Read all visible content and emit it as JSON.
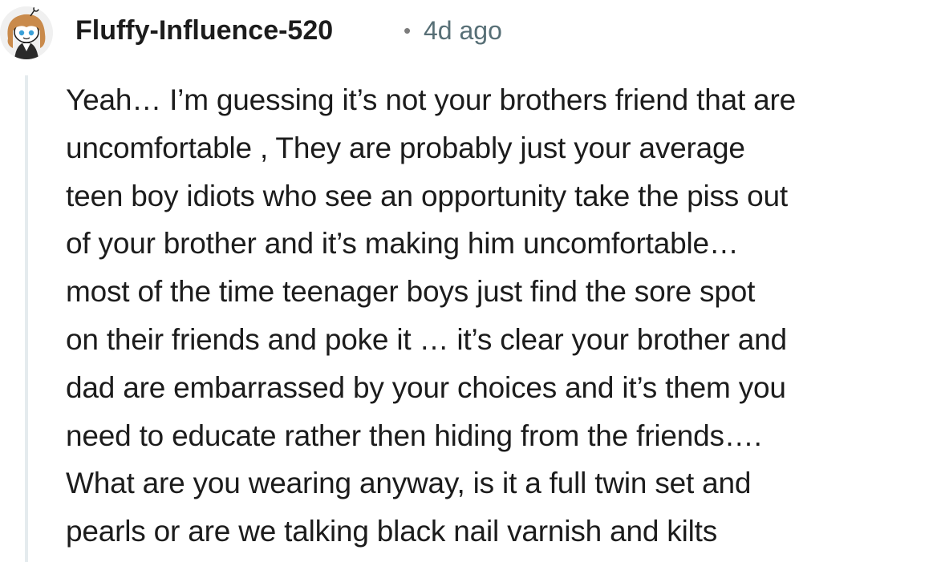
{
  "comment": {
    "author": "Fluffy-Influence-520",
    "separator": "•",
    "timestamp": "4d ago",
    "avatar_icon": "snoo-avatar-icon",
    "body_lines": [
      "Yeah… I’m guessing it’s not your brothers friend that are",
      "uncomfortable , They are probably just your average",
      "teen boy idiots who see an opportunity take the piss out",
      "of your brother and it’s making him uncomfortable…",
      "most of the time teenager boys just find the sore spot",
      "on their friends and poke it … it’s clear your brother and",
      "dad are embarrassed by your choices and it’s them you",
      "need to educate rather then hiding from the friends….",
      "What are you wearing anyway, is it a full twin set and",
      "pearls or are we talking black nail varnish and kilts"
    ]
  },
  "colors": {
    "text": "#1c1c1c",
    "meta": "#576f76",
    "thread_line": "#e5ebee",
    "avatar_hair": "#c98a4b",
    "avatar_eyes": "#3aa0d8"
  }
}
